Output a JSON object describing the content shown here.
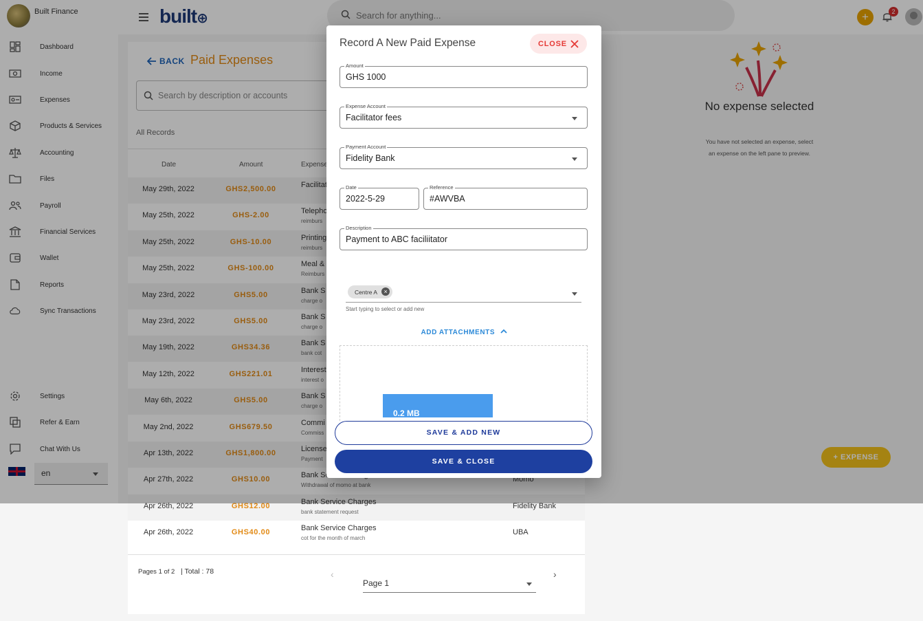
{
  "brand": {
    "name": "Built Finance",
    "logo_text": "built"
  },
  "sidebar": {
    "items": [
      {
        "label": "Dashboard",
        "icon": "dashboard-icon"
      },
      {
        "label": "Income",
        "icon": "cash-icon"
      },
      {
        "label": "Expenses",
        "icon": "expense-icon"
      },
      {
        "label": "Products & Services",
        "icon": "box-icon"
      },
      {
        "label": "Accounting",
        "icon": "scale-icon"
      },
      {
        "label": "Files",
        "icon": "folder-icon"
      },
      {
        "label": "Payroll",
        "icon": "people-icon"
      },
      {
        "label": "Financial Services",
        "icon": "bank-icon"
      },
      {
        "label": "Wallet",
        "icon": "wallet-icon"
      },
      {
        "label": "Reports",
        "icon": "document-icon"
      },
      {
        "label": "Sync Transactions",
        "icon": "cloud-sync-icon"
      }
    ],
    "bottom_items": [
      {
        "label": "Settings",
        "icon": "gear-icon"
      },
      {
        "label": "Refer & Earn",
        "icon": "share-icon"
      },
      {
        "label": "Chat With Us",
        "icon": "chat-icon"
      }
    ],
    "language": "en"
  },
  "topbar": {
    "search_placeholder": "Search for anything...",
    "notification_count": "2"
  },
  "list": {
    "back_label": "BACK",
    "title": "Paid Expenses",
    "search_placeholder": "Search by description or accounts",
    "filter_label": "All Records",
    "columns": [
      "Date",
      "Amount",
      "Expense"
    ],
    "rows": [
      {
        "date": "May 29th, 2022",
        "amount": "GHS2,500.00",
        "desc": "Facilitat",
        "sub": "",
        "account": ""
      },
      {
        "date": "May 25th, 2022",
        "amount": "GHS-2.00",
        "desc": "Telepho",
        "sub": "reimburs",
        "account": ""
      },
      {
        "date": "May 25th, 2022",
        "amount": "GHS-10.00",
        "desc": "Printing",
        "sub": "reimburs",
        "account": ""
      },
      {
        "date": "May 25th, 2022",
        "amount": "GHS-100.00",
        "desc": "Meal &",
        "sub": "Reimburs",
        "account": ""
      },
      {
        "date": "May 23rd, 2022",
        "amount": "GHS5.00",
        "desc": "Bank S",
        "sub": "charge o",
        "account": ""
      },
      {
        "date": "May 23rd, 2022",
        "amount": "GHS5.00",
        "desc": "Bank S",
        "sub": "charge o",
        "account": ""
      },
      {
        "date": "May 19th, 2022",
        "amount": "GHS34.36",
        "desc": "Bank S",
        "sub": "bank cot",
        "account": ""
      },
      {
        "date": "May 12th, 2022",
        "amount": "GHS221.01",
        "desc": "Interest",
        "sub": "interest o",
        "account": ""
      },
      {
        "date": "May 6th, 2022",
        "amount": "GHS5.00",
        "desc": "Bank S",
        "sub": "charge o",
        "account": ""
      },
      {
        "date": "May 2nd, 2022",
        "amount": "GHS679.50",
        "desc": "Commi",
        "sub": "Commiss",
        "account": ""
      },
      {
        "date": "Apr 13th, 2022",
        "amount": "GHS1,800.00",
        "desc": "License",
        "sub": "Payment",
        "account": ""
      },
      {
        "date": "Apr 27th, 2022",
        "amount": "GHS10.00",
        "desc": "Bank Service Charges",
        "sub": "Withdrawal of momo at bank",
        "account": "Momo"
      },
      {
        "date": "Apr 26th, 2022",
        "amount": "GHS12.00",
        "desc": "Bank Service Charges",
        "sub": "bank statement request",
        "account": "Fidelity Bank"
      },
      {
        "date": "Apr 26th, 2022",
        "amount": "GHS40.00",
        "desc": "Bank Service Charges",
        "sub": "cot for the month of march",
        "account": "UBA"
      }
    ],
    "pages_text": "Pages 1 of 2",
    "total_text": "| Total : 78",
    "page_select": "Page 1"
  },
  "preview": {
    "title": "No expense selected",
    "subtitle": "You have not selected an expense, select an expense on the left pane to preview."
  },
  "fab": {
    "label": "EXPENSE"
  },
  "modal": {
    "title": "Record A New Paid Expense",
    "close_label": "CLOSE",
    "amount": {
      "label": "Amount",
      "value": "GHS 1000"
    },
    "expense_account": {
      "label": "Expense Account",
      "value": "Facilitator fees"
    },
    "payment_account": {
      "label": "Payment Account",
      "value": "Fidelity Bank"
    },
    "date": {
      "label": "Date",
      "value": "2022-5-29"
    },
    "reference": {
      "label": "Reference",
      "value": "#AWVBA"
    },
    "description": {
      "label": "Description",
      "value": "Payment to ABC faciliitator"
    },
    "tag_chip": "Centre A",
    "tag_helper": "Start typing to select or add new",
    "attachments_label": "ADD ATTACHMENTS",
    "file_size": "0.2 MB",
    "save_add_label": "SAVE & ADD NEW",
    "save_close_label": "SAVE & CLOSE"
  },
  "colors": {
    "accent_orange": "#e28a15",
    "primary_blue": "#1e40a0",
    "danger": "#e53935",
    "fab_yellow": "#f3c21b"
  }
}
